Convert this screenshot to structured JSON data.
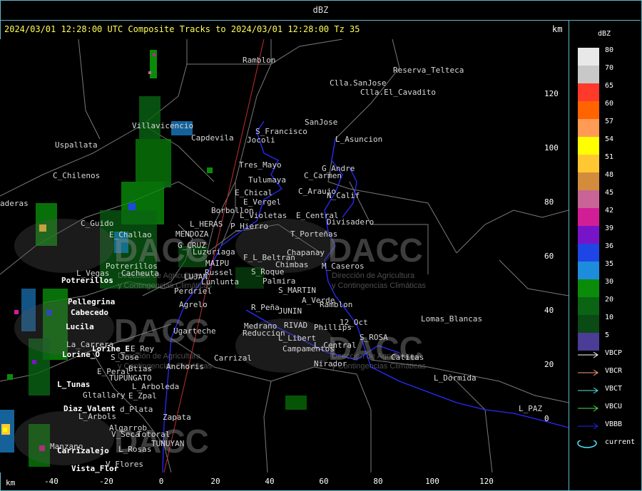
{
  "window": {
    "title": "dBZ"
  },
  "header": {
    "title": "2024/03/01 12:28:00 UTC Composite Tracks to 2024/03/01 12:28:00 Tz 35",
    "unit_top": "km",
    "unit_bottom": "km"
  },
  "legend": {
    "title": "dBZ",
    "items": [
      {
        "label": "80",
        "color": "#e8e8e8"
      },
      {
        "label": "70",
        "color": "#c8c8c8"
      },
      {
        "label": "65",
        "color": "#ff3a2a"
      },
      {
        "label": "60",
        "color": "#ff6400"
      },
      {
        "label": "57",
        "color": "#ff9b55"
      },
      {
        "label": "54",
        "color": "#ffff00"
      },
      {
        "label": "51",
        "color": "#ffc832"
      },
      {
        "label": "48",
        "color": "#d28c3c"
      },
      {
        "label": "45",
        "color": "#c86496"
      },
      {
        "label": "42",
        "color": "#d21e96"
      },
      {
        "label": "39",
        "color": "#7814c8"
      },
      {
        "label": "36",
        "color": "#1e46e6"
      },
      {
        "label": "35",
        "color": "#1e8cdc"
      },
      {
        "label": "30",
        "color": "#0a8c0a"
      },
      {
        "label": "20",
        "color": "#0a6414"
      },
      {
        "label": "10",
        "color": "#0a4a14"
      },
      {
        "label": "5",
        "color": "#4b3c96"
      }
    ]
  },
  "tracks": [
    {
      "label": "VBCP",
      "color": "#ffffff"
    },
    {
      "label": "VBCR",
      "color": "#ff9e7a"
    },
    {
      "label": "VBCT",
      "color": "#4fe6e6"
    },
    {
      "label": "VBCU",
      "color": "#50dc50"
    },
    {
      "label": "VBBB",
      "color": "#2222ee"
    },
    {
      "label": "current",
      "color": "#4fe6ff"
    }
  ],
  "axes": {
    "x_ticks": [
      "-40",
      "-20",
      "0",
      "20",
      "40",
      "60",
      "80",
      "100",
      "120"
    ],
    "y_ticks": [
      "120",
      "100",
      "80",
      "60",
      "40",
      "20",
      "0"
    ]
  },
  "watermark": {
    "logo_text": "DACC",
    "line1": "Dirección de Agricultura",
    "line2": "y Contingencias Climáticas"
  },
  "places": [
    {
      "name": "Ramblon",
      "hl": false
    },
    {
      "name": "Reserva_Telteca",
      "hl": false
    },
    {
      "name": "Clla.SanJose",
      "hl": false
    },
    {
      "name": "Clla.El_Cavadito",
      "hl": false
    },
    {
      "name": "SanJose",
      "hl": false
    },
    {
      "name": "Villavicencio",
      "hl": false
    },
    {
      "name": "Capdevila",
      "hl": false
    },
    {
      "name": "S_Francisco",
      "hl": false
    },
    {
      "name": "Jocoli",
      "hl": false
    },
    {
      "name": "L_Asuncion",
      "hl": false
    },
    {
      "name": "Uspallata",
      "hl": false
    },
    {
      "name": "C_Chilenos",
      "hl": false
    },
    {
      "name": "Tres_Mayo",
      "hl": false
    },
    {
      "name": "G_Andre",
      "hl": false
    },
    {
      "name": "C_Carmen",
      "hl": false
    },
    {
      "name": "Tulumaya",
      "hl": false
    },
    {
      "name": "C_Araujo",
      "hl": false
    },
    {
      "name": "E_Chical",
      "hl": false
    },
    {
      "name": "N_Calif",
      "hl": false
    },
    {
      "name": "E_Vergel",
      "hl": false
    },
    {
      "name": "aderas",
      "hl": false
    },
    {
      "name": "Borbollon",
      "hl": false
    },
    {
      "name": "L_Violetas",
      "hl": false
    },
    {
      "name": "E_Central",
      "hl": false
    },
    {
      "name": "Divisadero",
      "hl": false
    },
    {
      "name": "C_Guido",
      "hl": false
    },
    {
      "name": "L_HERAS",
      "hl": false
    },
    {
      "name": "P_Hierro",
      "hl": false
    },
    {
      "name": "E_Challao",
      "hl": false
    },
    {
      "name": "MENDOZA",
      "hl": false
    },
    {
      "name": "T_Porteñas",
      "hl": false
    },
    {
      "name": "G_CRUZ",
      "hl": false
    },
    {
      "name": "Luzuriaga",
      "hl": false
    },
    {
      "name": "F_L_Beltran",
      "hl": false
    },
    {
      "name": "Chapanay",
      "hl": false
    },
    {
      "name": "MAIPU",
      "hl": false
    },
    {
      "name": "Chimbas",
      "hl": false
    },
    {
      "name": "Potrerillos",
      "hl": false
    },
    {
      "name": "M_Caseros",
      "hl": false
    },
    {
      "name": "L_Vegas",
      "hl": false
    },
    {
      "name": "Cacheuta",
      "hl": false
    },
    {
      "name": "Russel",
      "hl": false
    },
    {
      "name": "S_Roque",
      "hl": false
    },
    {
      "name": "LUJAN",
      "hl": false
    },
    {
      "name": "Potrerillos",
      "hl": true
    },
    {
      "name": "Lunlunta",
      "hl": false
    },
    {
      "name": "Palmira",
      "hl": false
    },
    {
      "name": "Perdriel",
      "hl": false
    },
    {
      "name": "S_MARTIN",
      "hl": false
    },
    {
      "name": "Pellegrina",
      "hl": true
    },
    {
      "name": "A_Verde",
      "hl": false
    },
    {
      "name": "Ramblon",
      "hl": false
    },
    {
      "name": "Agrelo",
      "hl": false
    },
    {
      "name": "R_Peña",
      "hl": false
    },
    {
      "name": "JUNIN",
      "hl": false
    },
    {
      "name": "Cabecedo",
      "hl": true
    },
    {
      "name": "Lomas_Blancas",
      "hl": false
    },
    {
      "name": "Lucila",
      "hl": true
    },
    {
      "name": "Medrano",
      "hl": false
    },
    {
      "name": "RIVAD",
      "hl": false
    },
    {
      "name": "12_Oct",
      "hl": false
    },
    {
      "name": "Ugarteche",
      "hl": false
    },
    {
      "name": "Reduccion",
      "hl": false
    },
    {
      "name": "Phillips",
      "hl": false
    },
    {
      "name": "S_ROSA",
      "hl": false
    },
    {
      "name": "L_Libert",
      "hl": false
    },
    {
      "name": "La_Carrera",
      "hl": false
    },
    {
      "name": "L_Central",
      "hl": false
    },
    {
      "name": "Lorine_E",
      "hl": true
    },
    {
      "name": "Campamentos",
      "hl": false
    },
    {
      "name": "E_Rey",
      "hl": false
    },
    {
      "name": "Lorine_O",
      "hl": true
    },
    {
      "name": "Carrizal",
      "hl": false
    },
    {
      "name": "Catitas",
      "hl": false
    },
    {
      "name": "S_Jose",
      "hl": false
    },
    {
      "name": "Nirador",
      "hl": false
    },
    {
      "name": "Anchoris",
      "hl": false
    },
    {
      "name": "E_Peral",
      "hl": false
    },
    {
      "name": "Btias",
      "hl": false
    },
    {
      "name": "L_Dormida",
      "hl": false
    },
    {
      "name": "TUPUNGATO",
      "hl": false
    },
    {
      "name": "L_Tunas",
      "hl": true
    },
    {
      "name": "L_Arboleda",
      "hl": false
    },
    {
      "name": "Gltallary",
      "hl": false
    },
    {
      "name": "E_Zpal",
      "hl": false
    },
    {
      "name": "Diaz_Valent",
      "hl": true
    },
    {
      "name": "d_Plata",
      "hl": false
    },
    {
      "name": "L_PAZ",
      "hl": false
    },
    {
      "name": "L_Arbols",
      "hl": false
    },
    {
      "name": "Zapata",
      "hl": false
    },
    {
      "name": "Algarrob",
      "hl": false
    },
    {
      "name": "V_Seca",
      "hl": false
    },
    {
      "name": "Totoral",
      "hl": false
    },
    {
      "name": "Manzano",
      "hl": false
    },
    {
      "name": "Carrizalejo",
      "hl": true
    },
    {
      "name": "L_Rosas",
      "hl": false
    },
    {
      "name": "TUNUYAN",
      "hl": false
    },
    {
      "name": "V_Flores",
      "hl": false
    },
    {
      "name": "Vista_Flor",
      "hl": true
    }
  ]
}
